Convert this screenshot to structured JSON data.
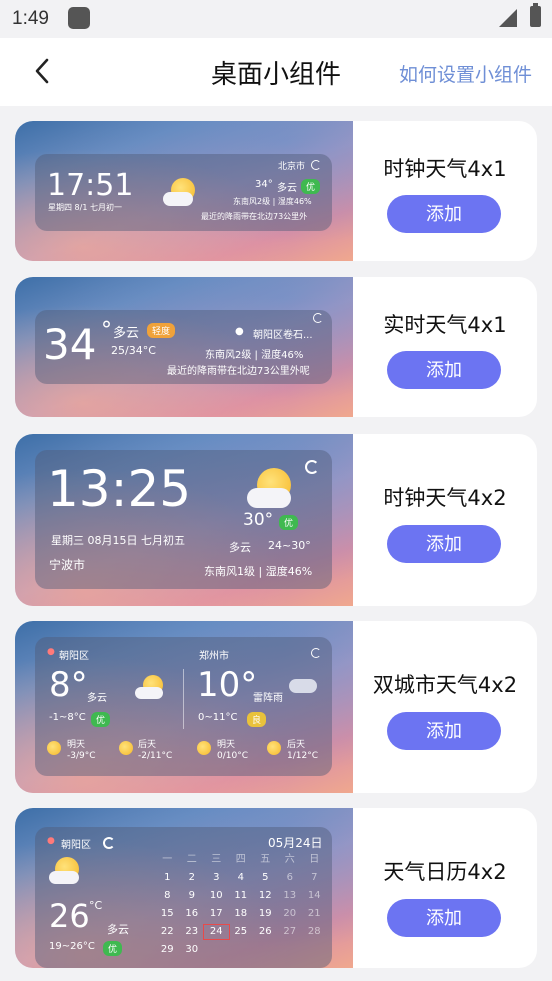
{
  "status": {
    "time": "1:49"
  },
  "header": {
    "title": "桌面小组件",
    "help_link": "如何设置小组件"
  },
  "add_label": "添加",
  "cards": [
    {
      "name": "时钟天气4x1",
      "preview": {
        "time": "17:51",
        "date": "星期四 8/1 七月初一",
        "city": "北京市",
        "temp": "34°",
        "cond": "多云",
        "aqi": "优",
        "wind_humidity": "东南风2级 | 湿度46%",
        "rain": "最近的降雨带在北边73公里外"
      }
    },
    {
      "name": "实时天气4x1",
      "preview": {
        "temp": "34",
        "deg": "°",
        "cond": "多云",
        "aqi": "轻度",
        "range": "25/34°C",
        "location": "朝阳区卷石...",
        "wind_humidity": "东南风2级 | 湿度46%",
        "rain": "最近的降雨带在北边73公里外呢"
      }
    },
    {
      "name": "时钟天气4x2",
      "preview": {
        "time": "13:25",
        "date": "星期三 08月15日 七月初五",
        "city": "宁波市",
        "temp": "30°",
        "aqi": "优",
        "cond": "多云",
        "range": "24~30°",
        "wind_humidity": "东南风1级 | 湿度46%"
      }
    },
    {
      "name": "双城市天气4x2",
      "preview": {
        "city1": {
          "name": "朝阳区",
          "temp": "8°",
          "cond": "多云",
          "range": "-1~8°C",
          "aqi": "优"
        },
        "city2": {
          "name": "郑州市",
          "temp": "10°",
          "cond": "雷阵雨",
          "range": "0~11°C",
          "aqi": "良"
        },
        "forecast": [
          {
            "day": "明天",
            "range": "-3/9°C"
          },
          {
            "day": "后天",
            "range": "-2/11°C"
          },
          {
            "day": "明天",
            "range": "0/10°C"
          },
          {
            "day": "后天",
            "range": "1/12°C"
          }
        ]
      }
    },
    {
      "name": "天气日历4x2",
      "preview": {
        "city": "朝阳区",
        "date": "05月24日",
        "temp": "26",
        "unit": "°C",
        "cond": "多云",
        "range": "19~26°C",
        "aqi": "优",
        "weekdays": [
          "一",
          "二",
          "三",
          "四",
          "五",
          "六",
          "日"
        ],
        "days": [
          "1",
          "2",
          "3",
          "4",
          "5",
          "6",
          "7",
          "8",
          "9",
          "10",
          "11",
          "12",
          "13",
          "14",
          "15",
          "16",
          "17",
          "18",
          "19",
          "20",
          "21",
          "22",
          "23",
          "24",
          "25",
          "26",
          "27",
          "28",
          "29",
          "30"
        ]
      }
    }
  ]
}
